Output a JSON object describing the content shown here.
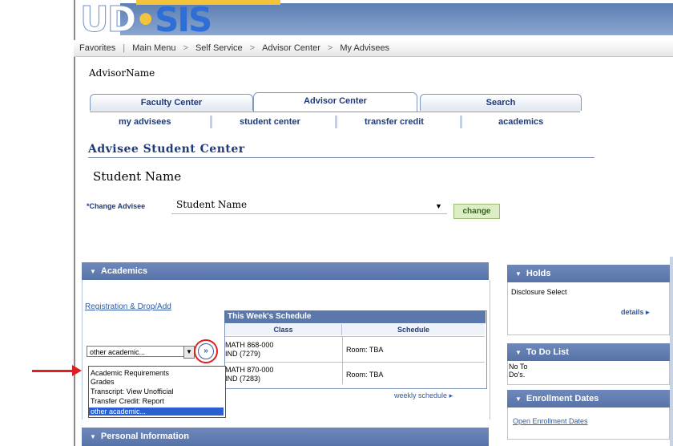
{
  "header": {
    "logo_text": "UDSIS",
    "colors": {
      "bar": "#6f8fc2",
      "accent": "#f2c33b",
      "logo": "#2e6fd6"
    }
  },
  "breadcrumb": [
    "Favorites",
    "Main Menu",
    "Self Service",
    "Advisor Center",
    "My Advisees"
  ],
  "advisor_name": "AdvisorName",
  "tabs": [
    "Faculty Center",
    "Advisor Center",
    "Search"
  ],
  "subtabs": [
    "my advisees",
    "student center",
    "transfer credit",
    "academics"
  ],
  "page_title": "Advisee Student Center",
  "student_name": "Student Name",
  "change_advisee": {
    "label": "*Change Advisee",
    "value": "Student Name",
    "button": "change"
  },
  "academics": {
    "title": "Academics",
    "reg_link": "Registration & Drop/Add",
    "schedule": {
      "title": "This Week's Schedule",
      "headers": [
        "Class",
        "Schedule"
      ],
      "rows": [
        {
          "class_line1": "MATH 868-000",
          "class_line2": "IND (7279)",
          "room": "Room:  TBA"
        },
        {
          "class_line1": "MATH 870-000",
          "class_line2": "IND (7283)",
          "room": "Room:  TBA"
        }
      ],
      "weekly_link": "weekly schedule"
    },
    "other_select": {
      "value": "other academic...",
      "options": [
        "Academic Requirements",
        "Grades",
        "Transcript: View Unofficial",
        "Transfer Credit: Report",
        "other academic..."
      ]
    }
  },
  "personal_info": "Personal Information",
  "holds": {
    "title": "Holds",
    "item": "Disclosure Select",
    "details": "details"
  },
  "todo": {
    "title": "To Do List",
    "line1": "No To",
    "line2": "Do's."
  },
  "enrollment": {
    "title": "Enrollment Dates",
    "link": "Open Enrollment Dates"
  }
}
